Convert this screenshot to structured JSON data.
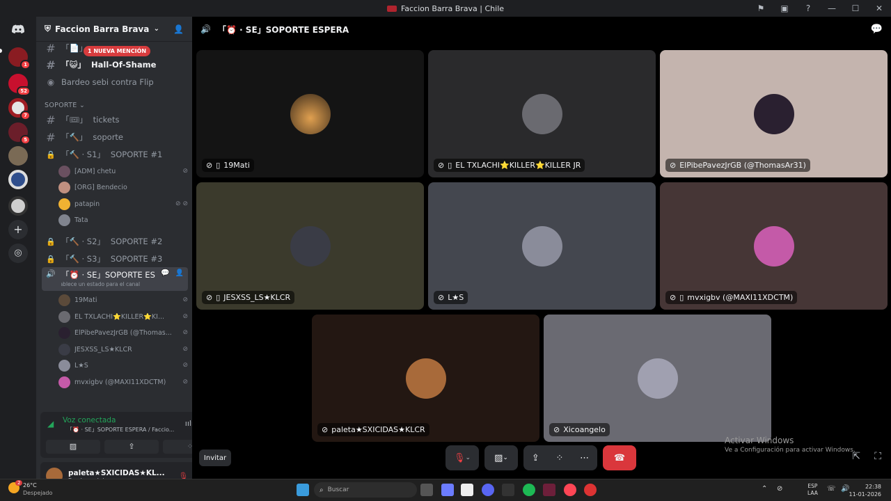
{
  "window": {
    "title": "Faccion Barra Brava | Chile"
  },
  "servers": [
    {
      "badge": "1",
      "color": "#8a1c22"
    },
    {
      "badge": "52",
      "color": "#c8102e"
    },
    {
      "badge": "7",
      "color": "#e6e6e6"
    },
    {
      "badge": "5",
      "color": "#6b1e2a"
    },
    {
      "badge": "",
      "color": "#7a6a55"
    },
    {
      "badge": "",
      "color": "#2f4e8c"
    },
    {
      "badge": "",
      "color": "#cfcfcf"
    }
  ],
  "server": {
    "name": "Faccion Barra Brava | C..."
  },
  "mention_pill": "1 NUEVA MENCIÓN",
  "channels": {
    "hall": "Hall-Of-Shame",
    "bardeo": "Bardeo sebi contra Flip",
    "category": "SOPORTE",
    "tickets": "tickets",
    "soporte": "soporte",
    "s1": "SOPORTE #1",
    "s1_prefix": "「🔨 · S1」",
    "s2": "SOPORTE #2",
    "s2_prefix": "「🔨 · S2」",
    "s3": "SOPORTE #3",
    "s3_prefix": "「🔨 · S3」",
    "se": "SOPORTE ES...",
    "se_prefix": "「⏰ · SE」",
    "se_status": "Establece un estado para el canal"
  },
  "s1_users": [
    "[ADM] chetu",
    "[ORG] Bendecio",
    "patapin",
    "Tata"
  ],
  "se_users": [
    "19Mati",
    "EL TXLACHI⭐KILLER⭐KI...",
    "ElPibePavezJrGB (@Thomas...",
    "JESXSS_LS★KLCR",
    "L★S",
    "mvxigbv (@MAXI11XDCTM)"
  ],
  "voice": {
    "status": "Voz conectada",
    "channel": "「⏰ · SE」SOPORTE ESPERA / Faccio..."
  },
  "user": {
    "name": "paleta★SXICIDAS★KL...",
    "status": "En el canal de voz"
  },
  "call": {
    "header": "「⏰ · SE」SOPORTE ESPERA",
    "invite": "Invitar"
  },
  "tiles": [
    {
      "label": "19Mati",
      "bg": "#141414",
      "av": "#5b4a3a",
      "phone": true
    },
    {
      "label": "EL TXLACHI⭐KILLER⭐KILLER JR",
      "bg": "#2a2a2c",
      "av": "#6a6a70",
      "phone": true
    },
    {
      "label": "ElPibePavezJrGB (@ThomasAr31)",
      "bg": "#c4b4ae",
      "av": "#2a2030",
      "phone": false
    },
    {
      "label": "JESXSS_LS★KLCR",
      "bg": "#3b3a2c",
      "av": "#3a3c46",
      "phone": true
    },
    {
      "label": "L★S",
      "bg": "#44474f",
      "av": "#8a8c9a",
      "phone": false
    },
    {
      "label": "mvxigbv (@MAXI11XDCTM)",
      "bg": "#463636",
      "av": "#c45aa8",
      "phone": true
    },
    {
      "label": "paleta★SXICIDAS★KLCR",
      "bg": "#231712",
      "av": "#a86a3a",
      "phone": false
    },
    {
      "label": "Xicoangelo",
      "bg": "#6a6a72",
      "av": "#a0a0b0",
      "phone": false
    }
  ],
  "watermark": {
    "title": "Activar Windows",
    "sub": "Ve a Configuración para activar Windows."
  },
  "taskbar": {
    "temp": "26°C",
    "weather": "Despejado",
    "search": "Buscar",
    "lang": "ESP",
    "region": "LAA",
    "time": "22:38",
    "date": "11-01-2026",
    "weather_badge": "2"
  }
}
